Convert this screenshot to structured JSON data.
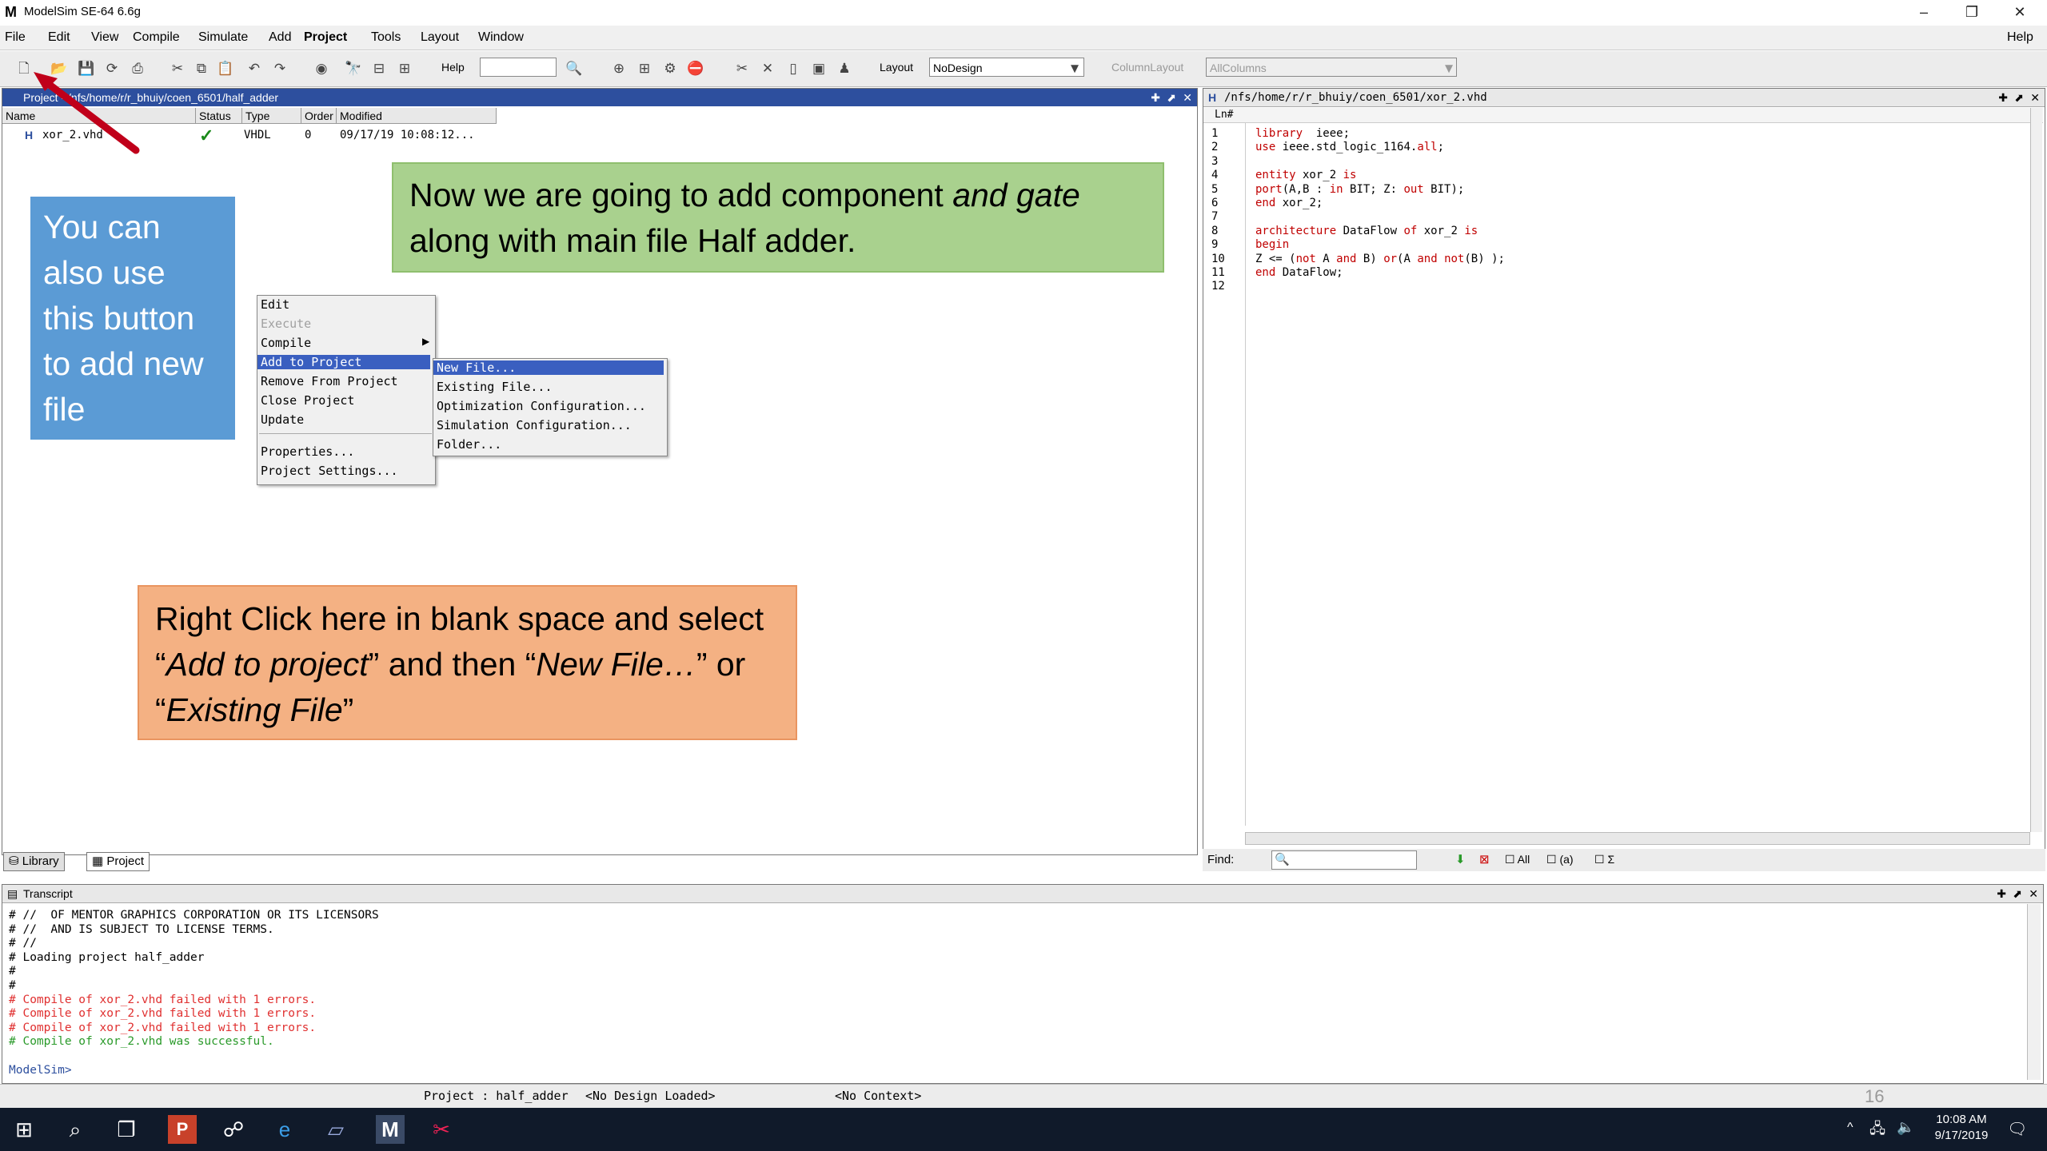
{
  "window": {
    "title": "ModelSim SE-64 6.6g",
    "help": "Help"
  },
  "menubar": [
    "File",
    "Edit",
    "View",
    "Compile",
    "Simulate",
    "Add",
    "Project",
    "Tools",
    "Layout",
    "Window"
  ],
  "toolbar": {
    "help_label": "Help",
    "layout_label": "Layout",
    "layout_value": "NoDesign",
    "column_layout_label": "ColumnLayout",
    "column_layout_value": "AllColumns"
  },
  "project_pane": {
    "title": "Project - /nfs/home/r/r_bhuiy/coen_6501/half_adder",
    "columns": [
      "Name",
      "Status",
      "Type",
      "Order",
      "Modified"
    ],
    "row": {
      "name": "xor_2.vhd",
      "status": "✓",
      "type": "VHDL",
      "order": "0",
      "modified": "09/17/19 10:08:12..."
    }
  },
  "context_menu": {
    "items": [
      {
        "label": "Edit",
        "disabled": false
      },
      {
        "label": "Execute",
        "disabled": true
      },
      {
        "label": "Compile",
        "disabled": false,
        "submenu": true
      },
      {
        "label": "Add to Project",
        "disabled": false,
        "submenu": true,
        "selected": true
      },
      {
        "label": "Remove From Project",
        "disabled": false
      },
      {
        "label": "Close Project",
        "disabled": false
      },
      {
        "label": "Update",
        "disabled": false
      },
      {
        "label": "Properties...",
        "disabled": false
      },
      {
        "label": "Project Settings...",
        "disabled": false
      }
    ],
    "submenu": [
      "New File...",
      "Existing File...",
      "Optimization Configuration...",
      "Simulation Configuration...",
      "Folder..."
    ]
  },
  "callouts": {
    "blue": "You can also use this button to add new file",
    "green_1": "Now we are going to add component ",
    "green_em": "and gate",
    "green_2": "along with main file Half adder.",
    "orange_1": "Right Click here in blank space and select “",
    "orange_em1": "Add to project",
    "orange_2": "” and then “",
    "orange_em2": "New File…",
    "orange_3": "” or “",
    "orange_em3": "Existing File",
    "orange_4": "”"
  },
  "editor": {
    "title": "/nfs/home/r/r_bhuiy/coen_6501/xor_2.vhd",
    "ln_header": "Ln#",
    "lines": [
      "library  ieee;",
      "use ieee.std_logic_1164.all;",
      "",
      "entity xor_2 is",
      "port(A,B : in BIT; Z: out BIT);",
      "end xor_2;",
      "",
      "architecture DataFlow of xor_2 is",
      "begin",
      "Z <= (not A and B) or(A and not(B) );",
      "end DataFlow;",
      ""
    ],
    "find_label": "Find:",
    "find_all": "All",
    "find_a": "(a)"
  },
  "bottom_tabs": [
    "Library",
    "Project"
  ],
  "transcript": {
    "title": "Transcript",
    "lines": [
      {
        "text": "# //  OF MENTOR GRAPHICS CORPORATION OR ITS LICENSORS",
        "kind": "normal"
      },
      {
        "text": "# //  AND IS SUBJECT TO LICENSE TERMS.",
        "kind": "normal"
      },
      {
        "text": "# //",
        "kind": "normal"
      },
      {
        "text": "# Loading project half_adder",
        "kind": "normal"
      },
      {
        "text": "#",
        "kind": "normal"
      },
      {
        "text": "#",
        "kind": "normal"
      },
      {
        "text": "# Compile of xor_2.vhd failed with 1 errors.",
        "kind": "err"
      },
      {
        "text": "# Compile of xor_2.vhd failed with 1 errors.",
        "kind": "err"
      },
      {
        "text": "# Compile of xor_2.vhd failed with 1 errors.",
        "kind": "err"
      },
      {
        "text": "# Compile of xor_2.vhd was successful.",
        "kind": "ok"
      },
      {
        "text": "",
        "kind": "normal"
      },
      {
        "text": "ModelSim>",
        "kind": "prompt"
      }
    ]
  },
  "statusbar": {
    "project": "Project : half_adder",
    "design": "<No Design Loaded>",
    "context": "<No Context>",
    "slide_number": "16"
  },
  "taskbar": {
    "time": "10:08 AM",
    "date": "9/17/2019"
  },
  "colors": {
    "pane_title": "#2d4f9e",
    "error": "#e03030",
    "ok": "#2a9a2a",
    "blue_callout": "#5b9bd5",
    "green_callout": "#a9d18e",
    "orange_callout": "#f4b183",
    "arrow": "#c0001a"
  }
}
